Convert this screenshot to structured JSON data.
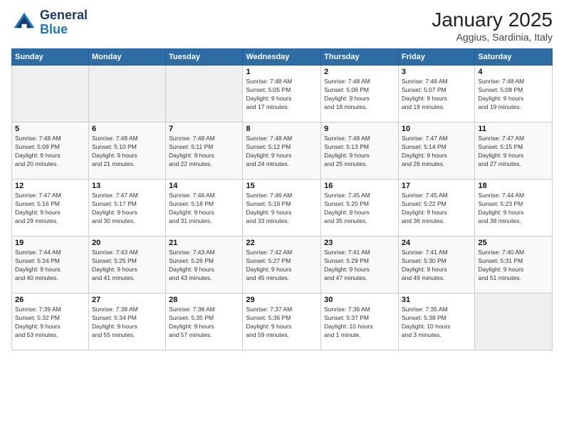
{
  "header": {
    "logo_line1": "General",
    "logo_line2": "Blue",
    "month_title": "January 2025",
    "location": "Aggius, Sardinia, Italy"
  },
  "weekdays": [
    "Sunday",
    "Monday",
    "Tuesday",
    "Wednesday",
    "Thursday",
    "Friday",
    "Saturday"
  ],
  "weeks": [
    [
      {
        "day": "",
        "info": ""
      },
      {
        "day": "",
        "info": ""
      },
      {
        "day": "",
        "info": ""
      },
      {
        "day": "1",
        "info": "Sunrise: 7:48 AM\nSunset: 5:05 PM\nDaylight: 9 hours\nand 17 minutes."
      },
      {
        "day": "2",
        "info": "Sunrise: 7:48 AM\nSunset: 5:06 PM\nDaylight: 9 hours\nand 18 minutes."
      },
      {
        "day": "3",
        "info": "Sunrise: 7:48 AM\nSunset: 5:07 PM\nDaylight: 9 hours\nand 19 minutes."
      },
      {
        "day": "4",
        "info": "Sunrise: 7:48 AM\nSunset: 5:08 PM\nDaylight: 9 hours\nand 19 minutes."
      }
    ],
    [
      {
        "day": "5",
        "info": "Sunrise: 7:48 AM\nSunset: 5:09 PM\nDaylight: 9 hours\nand 20 minutes."
      },
      {
        "day": "6",
        "info": "Sunrise: 7:48 AM\nSunset: 5:10 PM\nDaylight: 9 hours\nand 21 minutes."
      },
      {
        "day": "7",
        "info": "Sunrise: 7:48 AM\nSunset: 5:11 PM\nDaylight: 9 hours\nand 22 minutes."
      },
      {
        "day": "8",
        "info": "Sunrise: 7:48 AM\nSunset: 5:12 PM\nDaylight: 9 hours\nand 24 minutes."
      },
      {
        "day": "9",
        "info": "Sunrise: 7:48 AM\nSunset: 5:13 PM\nDaylight: 9 hours\nand 25 minutes."
      },
      {
        "day": "10",
        "info": "Sunrise: 7:47 AM\nSunset: 5:14 PM\nDaylight: 9 hours\nand 26 minutes."
      },
      {
        "day": "11",
        "info": "Sunrise: 7:47 AM\nSunset: 5:15 PM\nDaylight: 9 hours\nand 27 minutes."
      }
    ],
    [
      {
        "day": "12",
        "info": "Sunrise: 7:47 AM\nSunset: 5:16 PM\nDaylight: 9 hours\nand 29 minutes."
      },
      {
        "day": "13",
        "info": "Sunrise: 7:47 AM\nSunset: 5:17 PM\nDaylight: 9 hours\nand 30 minutes."
      },
      {
        "day": "14",
        "info": "Sunrise: 7:46 AM\nSunset: 5:18 PM\nDaylight: 9 hours\nand 31 minutes."
      },
      {
        "day": "15",
        "info": "Sunrise: 7:46 AM\nSunset: 5:19 PM\nDaylight: 9 hours\nand 33 minutes."
      },
      {
        "day": "16",
        "info": "Sunrise: 7:45 AM\nSunset: 5:20 PM\nDaylight: 9 hours\nand 35 minutes."
      },
      {
        "day": "17",
        "info": "Sunrise: 7:45 AM\nSunset: 5:22 PM\nDaylight: 9 hours\nand 36 minutes."
      },
      {
        "day": "18",
        "info": "Sunrise: 7:44 AM\nSunset: 5:23 PM\nDaylight: 9 hours\nand 38 minutes."
      }
    ],
    [
      {
        "day": "19",
        "info": "Sunrise: 7:44 AM\nSunset: 5:24 PM\nDaylight: 9 hours\nand 40 minutes."
      },
      {
        "day": "20",
        "info": "Sunrise: 7:43 AM\nSunset: 5:25 PM\nDaylight: 9 hours\nand 41 minutes."
      },
      {
        "day": "21",
        "info": "Sunrise: 7:43 AM\nSunset: 5:26 PM\nDaylight: 9 hours\nand 43 minutes."
      },
      {
        "day": "22",
        "info": "Sunrise: 7:42 AM\nSunset: 5:27 PM\nDaylight: 9 hours\nand 45 minutes."
      },
      {
        "day": "23",
        "info": "Sunrise: 7:41 AM\nSunset: 5:29 PM\nDaylight: 9 hours\nand 47 minutes."
      },
      {
        "day": "24",
        "info": "Sunrise: 7:41 AM\nSunset: 5:30 PM\nDaylight: 9 hours\nand 49 minutes."
      },
      {
        "day": "25",
        "info": "Sunrise: 7:40 AM\nSunset: 5:31 PM\nDaylight: 9 hours\nand 51 minutes."
      }
    ],
    [
      {
        "day": "26",
        "info": "Sunrise: 7:39 AM\nSunset: 5:32 PM\nDaylight: 9 hours\nand 53 minutes."
      },
      {
        "day": "27",
        "info": "Sunrise: 7:38 AM\nSunset: 5:34 PM\nDaylight: 9 hours\nand 55 minutes."
      },
      {
        "day": "28",
        "info": "Sunrise: 7:38 AM\nSunset: 5:35 PM\nDaylight: 9 hours\nand 57 minutes."
      },
      {
        "day": "29",
        "info": "Sunrise: 7:37 AM\nSunset: 5:36 PM\nDaylight: 9 hours\nand 59 minutes."
      },
      {
        "day": "30",
        "info": "Sunrise: 7:36 AM\nSunset: 5:37 PM\nDaylight: 10 hours\nand 1 minute."
      },
      {
        "day": "31",
        "info": "Sunrise: 7:35 AM\nSunset: 5:38 PM\nDaylight: 10 hours\nand 3 minutes."
      },
      {
        "day": "",
        "info": ""
      }
    ]
  ]
}
